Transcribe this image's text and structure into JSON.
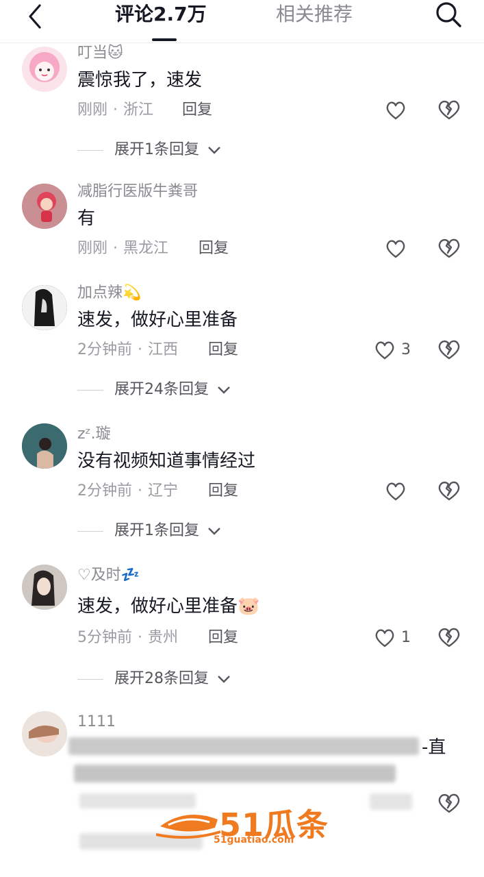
{
  "header": {
    "tab_comments": "评论2.7万",
    "tab_related": "相关推荐"
  },
  "comments": [
    {
      "user": "叮当🐱",
      "text": "震惊我了，速发",
      "time": "刚刚",
      "location": "浙江",
      "reply": "回复",
      "likes": "",
      "expand": "展开1条回复"
    },
    {
      "user": "减脂行医版牛粪哥",
      "text": "有",
      "time": "刚刚",
      "location": "黑龙江",
      "reply": "回复",
      "likes": "",
      "expand": ""
    },
    {
      "user": "加点辣💫",
      "text": "速发，做好心里准备",
      "time": "2分钟前",
      "location": "江西",
      "reply": "回复",
      "likes": "3",
      "expand": "展开24条回复"
    },
    {
      "user": "zᶻ.璇",
      "text": "没有视频知道事情经过",
      "time": "2分钟前",
      "location": "辽宁",
      "reply": "回复",
      "likes": "",
      "expand": "展开1条回复"
    },
    {
      "user": "♡及时💤",
      "text": "速发，做好心里准备🐷",
      "time": "5分钟前",
      "location": "贵州",
      "reply": "回复",
      "likes": "1",
      "expand": "展开28条回复"
    },
    {
      "user": "1111",
      "text_visible_end": "-直"
    }
  ],
  "watermark": {
    "brand": "51瓜条",
    "url": "51guatiao.com"
  },
  "colors": {
    "text_primary": "#161823",
    "text_secondary": "#8a8b91",
    "watermark": "#f07a20"
  }
}
